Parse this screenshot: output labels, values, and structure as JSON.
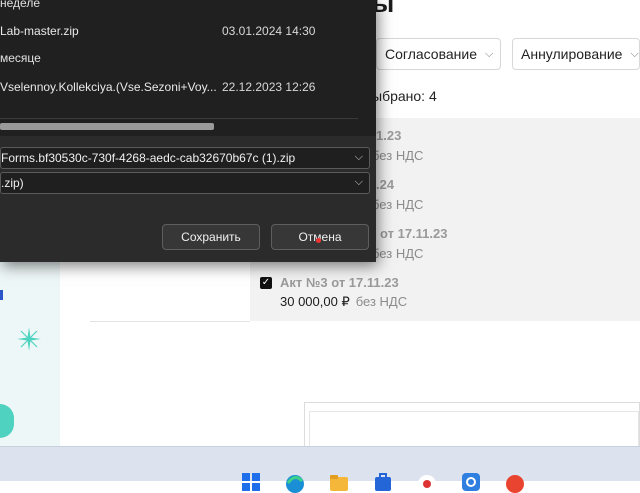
{
  "dialog": {
    "groups": [
      {
        "label": "неделе",
        "files": [
          {
            "name": "Lab-master.zip",
            "date": "03.01.2024 14:30"
          }
        ]
      },
      {
        "label": "месяце",
        "files": [
          {
            "name": "Vselennoy.Kollekciya.(Vse.Sezoni+Voy...",
            "date": "22.12.2023 12:26"
          }
        ]
      }
    ],
    "filename_value": "Forms.bf30530c-730f-4268-aedc-cab32670b67c (1).zip",
    "filetype_value": ".zip)",
    "save_label": "Сохранить",
    "cancel_label": "Отмена"
  },
  "page": {
    "heading_fragment": "ы",
    "filters": [
      "Согласование",
      "Аннулирование"
    ],
    "selected_count": "ыбрано: 4",
    "acts": [
      {
        "title": "1.23",
        "vat": "без НДС"
      },
      {
        "title": ".24",
        "vat": "без НДС"
      },
      {
        "title": "от 17.11.23",
        "vat": "без НДС"
      },
      {
        "title": "Акт №3 от 17.11.23",
        "amount": "30 000,00 ₽",
        "vat": "без НДС",
        "checked": true
      }
    ]
  },
  "taskbar": {
    "icons": [
      "windows-start-icon",
      "edge-icon",
      "file-explorer-icon",
      "store-icon",
      "chrome-icon",
      "settings-icon",
      "yandex-browser-icon"
    ]
  },
  "colors": {
    "dialog_bg": "#202020",
    "taskbar_bg": "#dde3ee",
    "accent_teal": "#4fd2c0"
  }
}
